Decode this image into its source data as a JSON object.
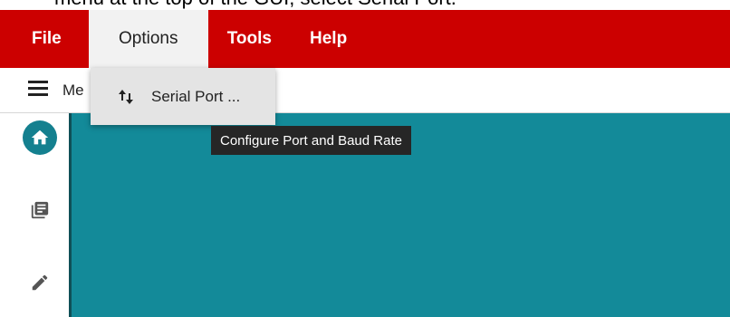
{
  "instruction_text": "menu at the top of the GUI, select Serial Port.",
  "menubar": {
    "items": [
      {
        "label": "File"
      },
      {
        "label": "Options"
      },
      {
        "label": "Tools"
      },
      {
        "label": "Help"
      }
    ],
    "active": "Options"
  },
  "toolbar": {
    "label": "Me"
  },
  "dropdown": {
    "items": [
      {
        "label": "Serial Port ...",
        "icon": "sort-arrows-icon"
      }
    ]
  },
  "tooltip": {
    "text": "Configure Port and Baud Rate"
  },
  "sidebar": {
    "icons": [
      "home-icon",
      "library-books-icon",
      "pencil-icon"
    ]
  },
  "colors": {
    "menubar": "#cc0000",
    "content": "#138a99",
    "home_button": "#14808f",
    "tooltip": "#262626"
  }
}
